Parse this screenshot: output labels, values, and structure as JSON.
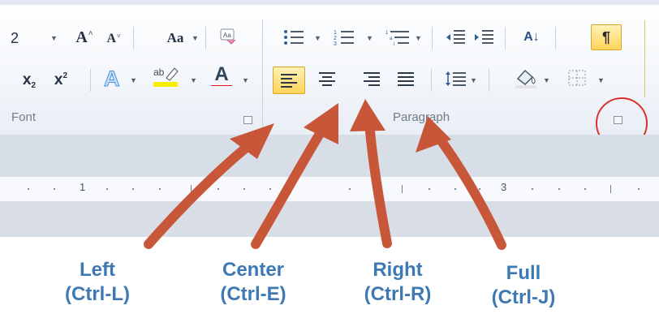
{
  "ribbon": {
    "font": {
      "size_value": "2",
      "grow_font": "A",
      "shrink_font": "A",
      "change_case": "Aa",
      "subscript": "x",
      "subscript_mark": "2",
      "superscript": "x",
      "superscript_mark": "2",
      "font_color": "A",
      "label": "Font"
    },
    "paragraph": {
      "sort": "A↓",
      "pilcrow": "¶",
      "label": "Paragraph"
    }
  },
  "ruler": {
    "numbers": [
      "1",
      "3"
    ]
  },
  "captions": [
    {
      "name": "Left",
      "shortcut": "(Ctrl-L)"
    },
    {
      "name": "Center",
      "shortcut": "(Ctrl-E)"
    },
    {
      "name": "Right",
      "shortcut": "(Ctrl-R)"
    },
    {
      "name": "Full",
      "shortcut": "(Ctrl-J)"
    }
  ],
  "colors": {
    "caption_text": "#3e79b3",
    "arrow": "#c8573a",
    "highlight_circle": "#d8322b",
    "active_button": "#ffd35a"
  },
  "icons": [
    "grow-font-icon",
    "shrink-font-icon",
    "bullets-icon",
    "numbering-icon",
    "multilevel-list-icon",
    "decrease-indent-icon",
    "increase-indent-icon",
    "sort-icon",
    "show-formatting-icon",
    "text-effects-icon",
    "highlight-icon",
    "font-color-icon",
    "align-left-icon",
    "align-center-icon",
    "align-right-icon",
    "justify-icon",
    "line-spacing-icon",
    "shading-icon",
    "borders-icon",
    "dialog-launcher-icon"
  ]
}
